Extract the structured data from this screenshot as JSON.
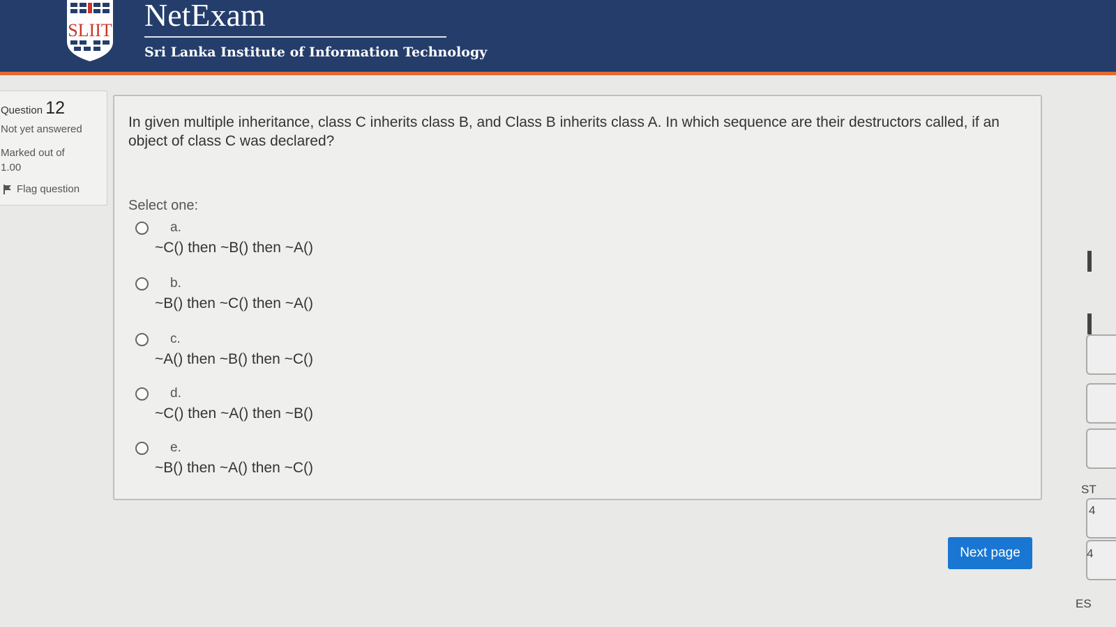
{
  "header": {
    "logo_text": "SLIIT",
    "brand_title": "NetExam",
    "brand_subtitle": "Sri Lanka Institute of Information Technology"
  },
  "info": {
    "question_label": "Question",
    "question_number": "12",
    "state": "Not yet answered",
    "marked_out_of": "Marked out of 1.00",
    "flag_label": "Flag question"
  },
  "question": {
    "text": "In given multiple inheritance, class C inherits class B, and Class B inherits class A. In which sequence are their destructors called, if an object of class C was declared?",
    "select_one": "Select one:",
    "options": [
      {
        "letter": "a.",
        "text": "~C() then ~B() then ~A()"
      },
      {
        "letter": "b.",
        "text": "~B() then ~C() then ~A()"
      },
      {
        "letter": "c.",
        "text": "~A() then ~B() then ~C()"
      },
      {
        "letter": "d.",
        "text": "~C() then ~A() then ~B()"
      },
      {
        "letter": "e.",
        "text": "~B() then ~A() then ~C()"
      }
    ]
  },
  "navigation": {
    "next_label": "Next page"
  },
  "right_edge": {
    "fragment_1": "ST",
    "fragment_2": "4",
    "fragment_3": "4",
    "fragment_4": "ES"
  },
  "colors": {
    "header_bg": "#243d6b",
    "header_accent": "#e36b2f",
    "button_bg": "#1976d2"
  }
}
